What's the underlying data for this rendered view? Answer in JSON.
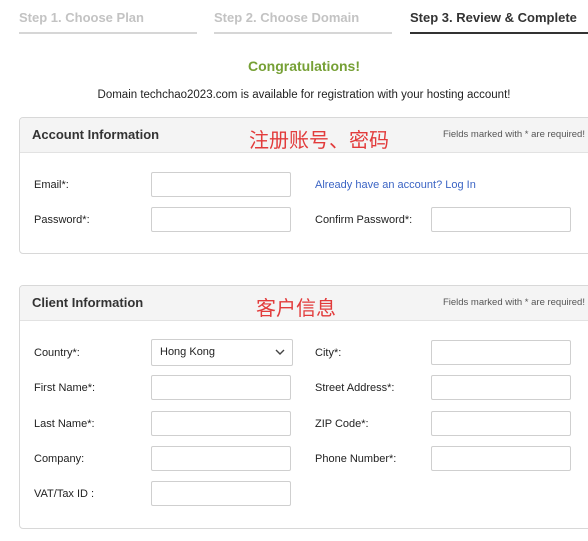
{
  "steps": [
    {
      "label": "Step 1. Choose Plan"
    },
    {
      "label": "Step 2. Choose Domain"
    },
    {
      "label": "Step 3. Review & Complete"
    }
  ],
  "congrats": "Congratulations!",
  "domain_message": "Domain techchao2023.com is available for registration with your hosting account!",
  "account": {
    "title": "Account Information",
    "note": "Fields marked with * are required!",
    "annotation": "注册账号、密码",
    "email_label": "Email*:",
    "email_value": "",
    "login_link": "Already have an account? Log In",
    "password_label": "Password*:",
    "password_value": "",
    "confirm_label": "Confirm Password*:",
    "confirm_value": ""
  },
  "client": {
    "title": "Client Information",
    "note": "Fields marked with * are required!",
    "annotation": "客户信息",
    "country_label": "Country*:",
    "country_value": "Hong Kong",
    "city_label": "City*:",
    "first_name_label": "First Name*:",
    "street_label": "Street Address*:",
    "last_name_label": "Last Name*:",
    "zip_label": "ZIP Code*:",
    "company_label": "Company:",
    "phone_label": "Phone Number*:",
    "vat_label": "VAT/Tax ID :"
  },
  "icons": {
    "select_arrow": "chevron-down-icon"
  },
  "colors": {
    "success": "#76a035",
    "link": "#3b64c4",
    "annotation": "#e23b3b"
  }
}
